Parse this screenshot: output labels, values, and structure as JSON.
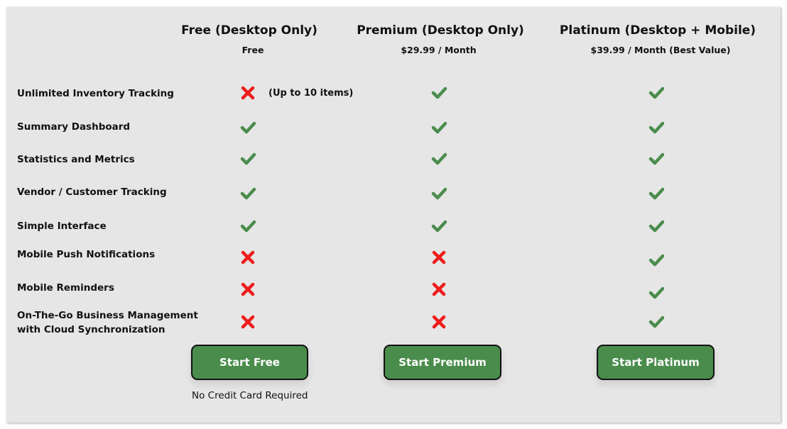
{
  "plans": [
    {
      "title": "Free (Desktop Only)",
      "price": "Free",
      "button": "Start Free",
      "button_note": "No Credit Card Required"
    },
    {
      "title": "Premium (Desktop Only)",
      "price": "$29.99 / Month",
      "button": "Start Premium"
    },
    {
      "title": "Platinum (Desktop + Mobile)",
      "price": "$39.99 / Month (Best Value)",
      "button": "Start Platinum"
    }
  ],
  "features": [
    {
      "label": "Unlimited Inventory Tracking",
      "free": "cross",
      "premium": "check",
      "platinum": "check",
      "free_note": "(Up to 10 items)"
    },
    {
      "label": "Summary Dashboard",
      "free": "check",
      "premium": "check",
      "platinum": "check"
    },
    {
      "label": "Statistics and Metrics",
      "free": "check",
      "premium": "check",
      "platinum": "check"
    },
    {
      "label": "Vendor / Customer Tracking",
      "free": "check",
      "premium": "check",
      "platinum": "check"
    },
    {
      "label": "Simple Interface",
      "free": "check",
      "premium": "check",
      "platinum": "check"
    },
    {
      "label": "Mobile Push Notifications",
      "free": "cross",
      "premium": "cross",
      "platinum": "check"
    },
    {
      "label": "Mobile Reminders",
      "free": "cross",
      "premium": "cross",
      "platinum": "check"
    },
    {
      "label": "On-The-Go Business Management",
      "label_line2": "with Cloud Synchronization",
      "free": "cross",
      "premium": "cross",
      "platinum": "check"
    }
  ],
  "icons": {
    "check": "check-icon",
    "cross": "cross-icon"
  },
  "colors": {
    "check": "#4a8c4c",
    "cross": "#ee1c1c",
    "button_bg": "#4a8c4c",
    "panel_bg": "#e6e6e6"
  }
}
